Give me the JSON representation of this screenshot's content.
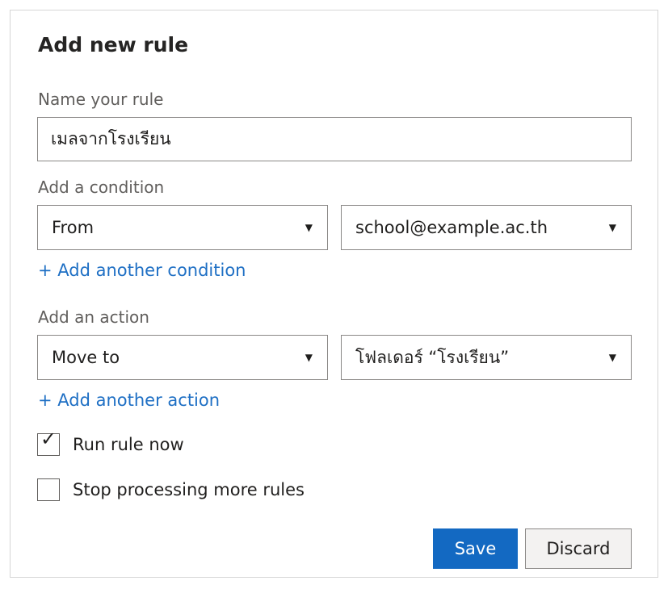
{
  "dialog": {
    "title": "Add new rule"
  },
  "rule_name": {
    "label": "Name your rule",
    "value": "เมลจากโรงเรียน"
  },
  "condition": {
    "label": "Add a condition",
    "field": "From",
    "value": "school@example.ac.th",
    "add_link": "+ Add another condition"
  },
  "action": {
    "label": "Add an action",
    "type": "Move to",
    "target": "โฟลเดอร์ “โรงเรียน”",
    "add_link": "+ Add another action"
  },
  "options": [
    {
      "label": "Run rule now",
      "checked": true
    },
    {
      "label": "Stop processing more rules",
      "checked": false
    }
  ],
  "buttons": {
    "save": "Save",
    "discard": "Discard"
  },
  "icons": {
    "dropdown": "caret-down-icon",
    "check": "check-mark-icon"
  },
  "colors": {
    "accent": "#1369c2",
    "link": "#1e6fc4",
    "border": "#8a8886",
    "label": "#605e5c"
  }
}
